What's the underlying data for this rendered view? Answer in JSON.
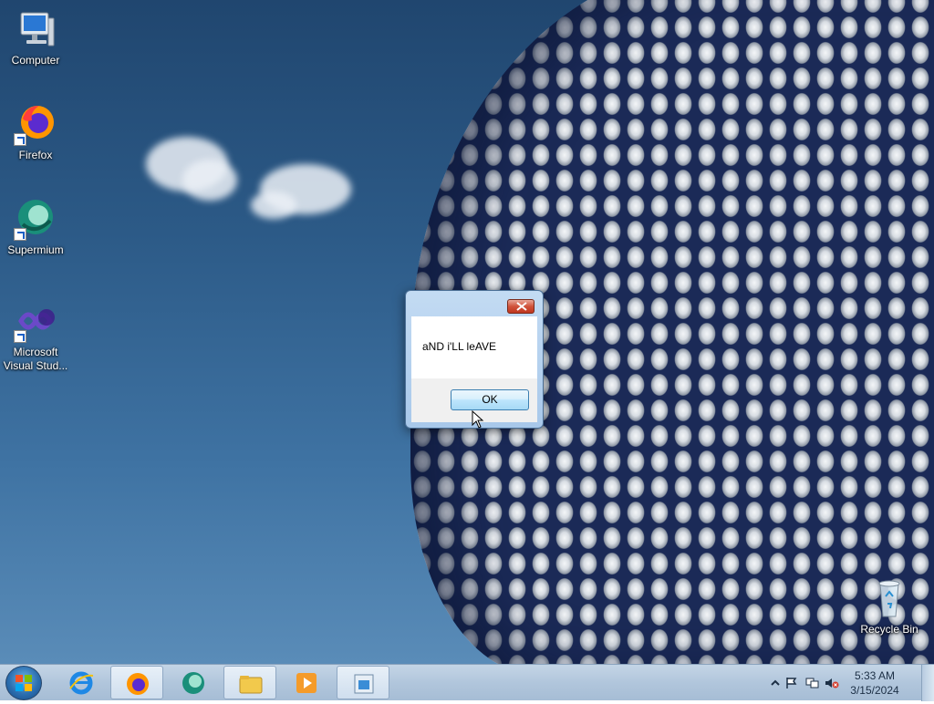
{
  "desktop": {
    "icons": [
      {
        "label": "Computer",
        "icon": "computer-icon"
      },
      {
        "label": "Firefox",
        "icon": "firefox-icon"
      },
      {
        "label": "Supermium",
        "icon": "supermium-icon"
      },
      {
        "label": "Microsoft Visual Stud...",
        "icon": "visual-studio-icon"
      },
      {
        "label": "Recycle Bin",
        "icon": "recycle-bin-icon"
      }
    ]
  },
  "dialog": {
    "message": "aND i'LL leAVE",
    "ok_label": "OK",
    "close_icon": "close-icon"
  },
  "taskbar": {
    "start_icon": "windows-start-icon",
    "items": [
      {
        "icon": "internet-explorer-icon",
        "active": false
      },
      {
        "icon": "firefox-icon",
        "active": true
      },
      {
        "icon": "supermium-icon",
        "active": false
      },
      {
        "icon": "file-explorer-icon",
        "active": true
      },
      {
        "icon": "media-player-icon",
        "active": false
      },
      {
        "icon": "installer-app-icon",
        "active": true
      }
    ],
    "tray": {
      "icons": [
        "show-hidden-icons-icon",
        "action-center-flag-icon",
        "network-icon",
        "volume-muted-icon"
      ],
      "time": "5:33 AM",
      "date": "3/15/2024"
    }
  }
}
